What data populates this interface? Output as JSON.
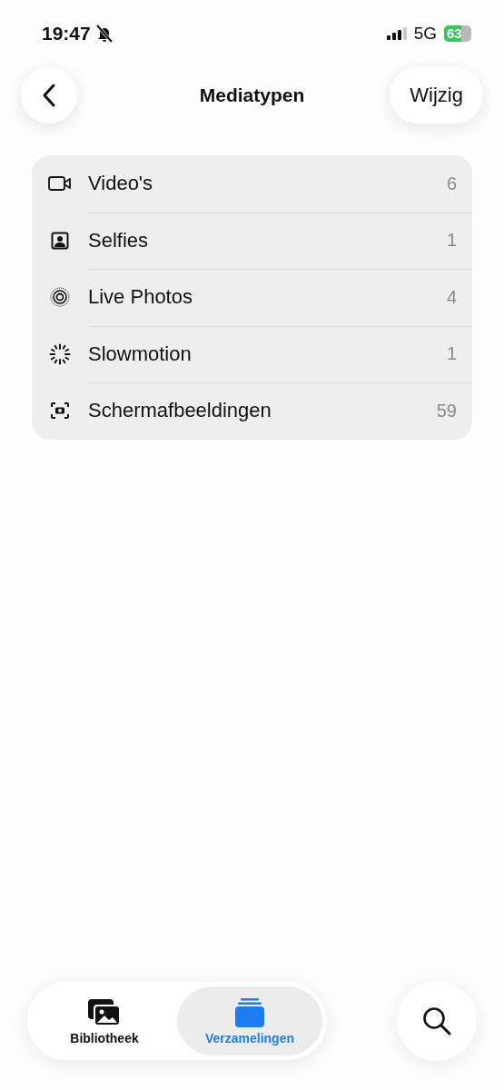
{
  "status_bar": {
    "time": "19:47",
    "network": "5G",
    "battery": "63",
    "silent": true
  },
  "nav": {
    "title": "Mediatypen",
    "edit_button": "Wijzig"
  },
  "media_types": [
    {
      "kind": "video",
      "label": "Video's",
      "count": "6"
    },
    {
      "kind": "selfie",
      "label": "Selfies",
      "count": "1"
    },
    {
      "kind": "live",
      "label": "Live Photos",
      "count": "4"
    },
    {
      "kind": "slowmo",
      "label": "Slowmotion",
      "count": "1"
    },
    {
      "kind": "screenshot",
      "label": "Schermafbeeldingen",
      "count": "59"
    }
  ],
  "tabs": [
    {
      "kind": "library",
      "label": "Bibliotheek",
      "selected": false
    },
    {
      "kind": "collections",
      "label": "Verzamelingen",
      "selected": true
    }
  ]
}
